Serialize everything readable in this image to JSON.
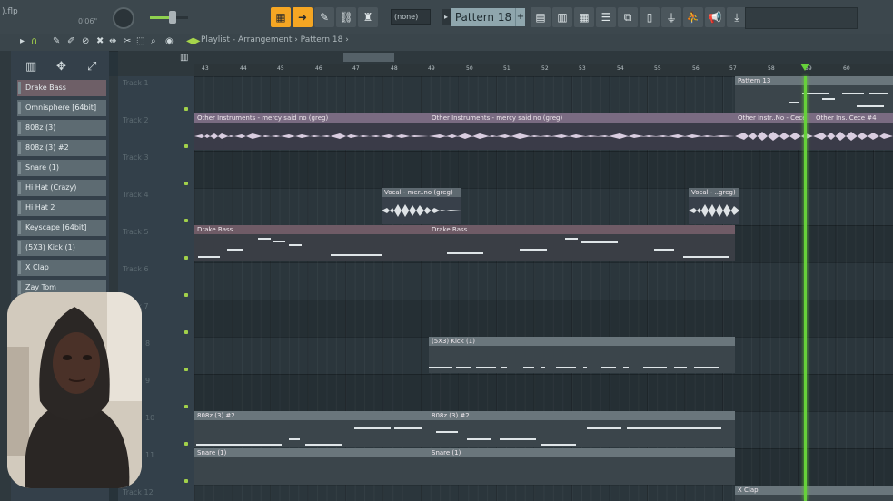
{
  "app": {
    "file_name": ").flp",
    "time": "0'06\""
  },
  "toolbar": {
    "snap_value": "(none)",
    "pattern_name": "Pattern 18",
    "pattern_plus": "+"
  },
  "playlist": {
    "title": "Playlist - Arrangement › Pattern 18 ›"
  },
  "ruler": {
    "bars": [
      "43",
      "44",
      "45",
      "46",
      "47",
      "48",
      "49",
      "50",
      "51",
      "52",
      "53",
      "54",
      "55",
      "56",
      "57",
      "58",
      "59",
      "60"
    ]
  },
  "picker": {
    "items": [
      "Drake Bass",
      "Omnisphere [64bit]",
      "808z (3)",
      "808z (3) #2",
      "Snare (1)",
      "Hi Hat (Crazy)",
      "Hi Hat 2",
      "Keyscape [64bit]",
      "(5X3) Kick (1)",
      "X Clap",
      "Zay Tom"
    ]
  },
  "tracks": [
    "Track 1",
    "Track 2",
    "Track 3",
    "Track 4",
    "Track 5",
    "Track 6",
    "Track 7",
    "8",
    "9",
    "10",
    "11",
    "Track 12"
  ],
  "clips": {
    "pattern13": "Pattern 13",
    "other1": "Other Instruments - mercy said no (greg)",
    "other2": "Other Instruments - mercy said no (greg)",
    "other3": "Other Instr..No - Cece",
    "other4": "Other Ins..Cece #4",
    "vocal1": "Vocal - mer..no (greg)",
    "vocal2": "Vocal - ..greg)",
    "drake1": "Drake Bass",
    "drake2": "Drake Bass",
    "kick": "(5X3) Kick (1)",
    "b808a": "808z (3) #2",
    "b808b": "808z (3) #2",
    "snare1": "Snare (1)",
    "snare2": "Snare (1)",
    "clap": "X Clap"
  }
}
